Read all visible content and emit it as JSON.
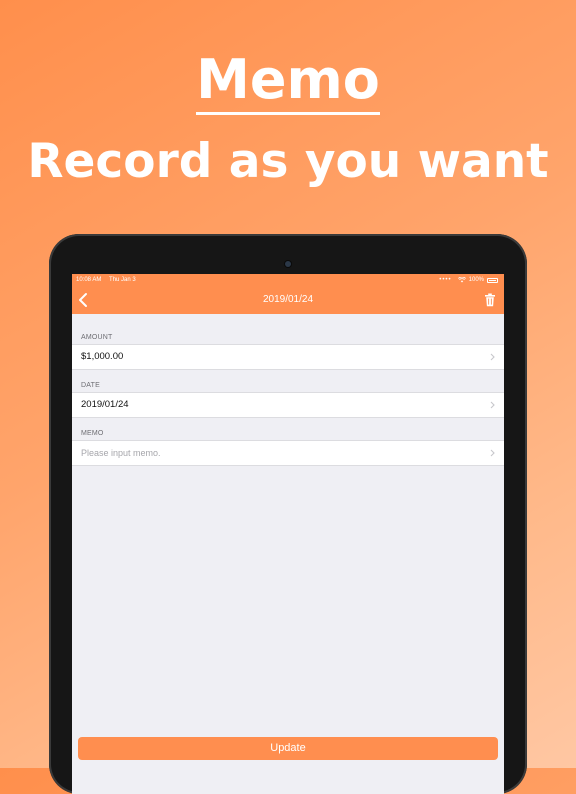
{
  "promo": {
    "title": "Memo",
    "subtitle": "Record as you want"
  },
  "statusbar": {
    "time": "10:08 AM",
    "date": "Thu Jan 3",
    "battery": "100%"
  },
  "navbar": {
    "title": "2019/01/24",
    "back_icon": "chevron-left-icon",
    "delete_icon": "trash-icon"
  },
  "form": {
    "amount": {
      "label": "AMOUNT",
      "value": "$1,000.00"
    },
    "date": {
      "label": "DATE",
      "value": "2019/01/24"
    },
    "memo": {
      "label": "MEMO",
      "placeholder": "Please input memo."
    }
  },
  "actions": {
    "update_label": "Update"
  },
  "colors": {
    "accent": "#ff8e4f",
    "background": "#efeff4",
    "text": "#111111",
    "placeholder": "#a6a6ab"
  }
}
